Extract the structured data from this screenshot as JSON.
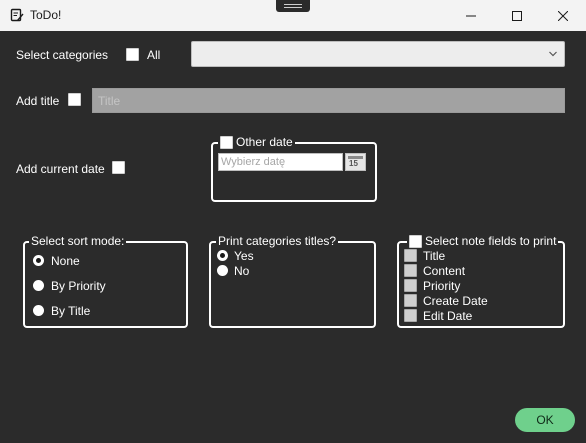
{
  "window": {
    "title": "ToDo!"
  },
  "categories": {
    "label": "Select categories",
    "all_label": "All",
    "selected": ""
  },
  "title_field": {
    "label": "Add title",
    "placeholder": "Title"
  },
  "current_date": {
    "label": "Add current date"
  },
  "other_date": {
    "legend": "Other date",
    "placeholder": "Wybierz datę",
    "calendar_day": "15"
  },
  "sort_mode": {
    "legend": "Select sort mode:",
    "options": [
      "None",
      "By Priority",
      "By Title"
    ],
    "selected": "None"
  },
  "print_titles": {
    "legend": "Print categories titles?",
    "options": [
      "Yes",
      "No"
    ],
    "selected": "Yes"
  },
  "note_fields": {
    "legend": "Select note fields to print",
    "fields": [
      "Title",
      "Content",
      "Priority",
      "Create Date",
      "Edit Date"
    ]
  },
  "ok_button": {
    "label": "OK"
  },
  "colors": {
    "background": "#2b2b2b",
    "titlebar": "#f3f3f3",
    "accent_ok": "#6fd08c",
    "disabled_input": "#a2a2a2"
  }
}
